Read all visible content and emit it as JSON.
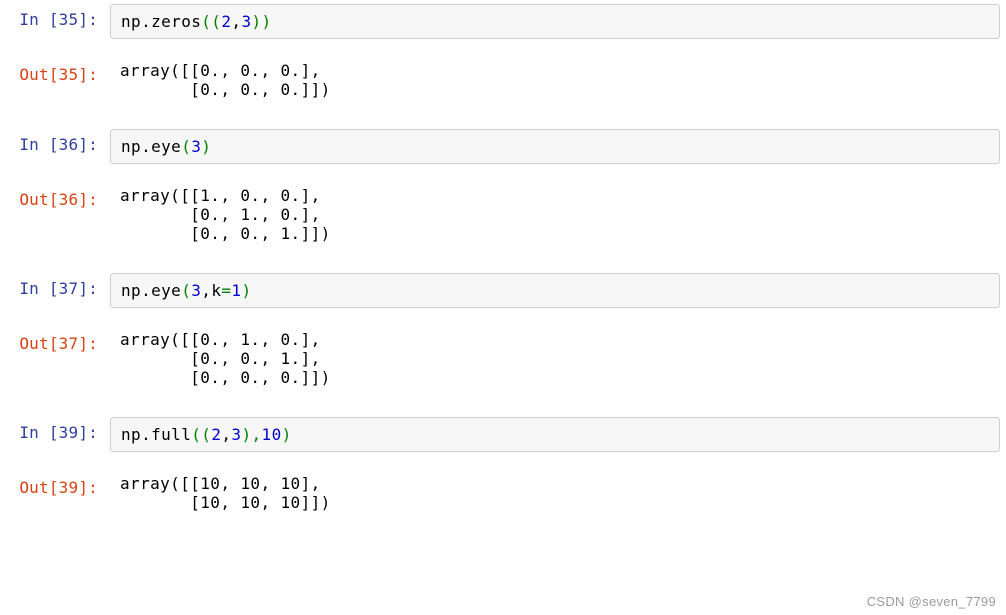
{
  "cells": [
    {
      "in_prompt": "In  [35]:",
      "out_prompt": "Out[35]:",
      "code_tokens": [
        {
          "t": "np.zeros",
          "c": ""
        },
        {
          "t": "((",
          "c": "green"
        },
        {
          "t": "2",
          "c": "blue"
        },
        {
          "t": ",",
          "c": ""
        },
        {
          "t": "3",
          "c": "blue"
        },
        {
          "t": "))",
          "c": "green"
        }
      ],
      "output": "array([[0., 0., 0.],\n       [0., 0., 0.]])"
    },
    {
      "in_prompt": "In  [36]:",
      "out_prompt": "Out[36]:",
      "code_tokens": [
        {
          "t": "np.eye",
          "c": ""
        },
        {
          "t": "(",
          "c": "green"
        },
        {
          "t": "3",
          "c": "blue"
        },
        {
          "t": ")",
          "c": "green"
        }
      ],
      "output": "array([[1., 0., 0.],\n       [0., 1., 0.],\n       [0., 0., 1.]])"
    },
    {
      "in_prompt": "In  [37]:",
      "out_prompt": "Out[37]:",
      "code_tokens": [
        {
          "t": "np.eye",
          "c": ""
        },
        {
          "t": "(",
          "c": "green"
        },
        {
          "t": "3",
          "c": "blue"
        },
        {
          "t": ",k",
          "c": ""
        },
        {
          "t": "=",
          "c": "green"
        },
        {
          "t": "1",
          "c": "blue"
        },
        {
          "t": ")",
          "c": "green"
        }
      ],
      "output": "array([[0., 1., 0.],\n       [0., 0., 1.],\n       [0., 0., 0.]])"
    },
    {
      "in_prompt": "In  [39]:",
      "out_prompt": "Out[39]:",
      "code_tokens": [
        {
          "t": "np.full",
          "c": ""
        },
        {
          "t": "((",
          "c": "green"
        },
        {
          "t": "2",
          "c": "blue"
        },
        {
          "t": ",",
          "c": ""
        },
        {
          "t": "3",
          "c": "blue"
        },
        {
          "t": "),",
          "c": "green"
        },
        {
          "t": "10",
          "c": "blue"
        },
        {
          "t": ")",
          "c": "green"
        }
      ],
      "output": "array([[10, 10, 10],\n       [10, 10, 10]])"
    }
  ],
  "watermark": "CSDN @seven_7799"
}
